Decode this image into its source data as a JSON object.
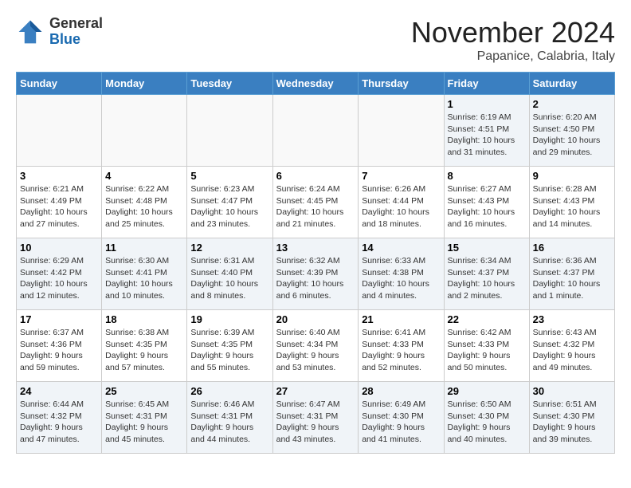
{
  "header": {
    "logo_line1": "General",
    "logo_line2": "Blue",
    "month": "November 2024",
    "location": "Papanice, Calabria, Italy"
  },
  "days_of_week": [
    "Sunday",
    "Monday",
    "Tuesday",
    "Wednesday",
    "Thursday",
    "Friday",
    "Saturday"
  ],
  "weeks": [
    [
      {
        "day": "",
        "detail": ""
      },
      {
        "day": "",
        "detail": ""
      },
      {
        "day": "",
        "detail": ""
      },
      {
        "day": "",
        "detail": ""
      },
      {
        "day": "",
        "detail": ""
      },
      {
        "day": "1",
        "detail": "Sunrise: 6:19 AM\nSunset: 4:51 PM\nDaylight: 10 hours\nand 31 minutes."
      },
      {
        "day": "2",
        "detail": "Sunrise: 6:20 AM\nSunset: 4:50 PM\nDaylight: 10 hours\nand 29 minutes."
      }
    ],
    [
      {
        "day": "3",
        "detail": "Sunrise: 6:21 AM\nSunset: 4:49 PM\nDaylight: 10 hours\nand 27 minutes."
      },
      {
        "day": "4",
        "detail": "Sunrise: 6:22 AM\nSunset: 4:48 PM\nDaylight: 10 hours\nand 25 minutes."
      },
      {
        "day": "5",
        "detail": "Sunrise: 6:23 AM\nSunset: 4:47 PM\nDaylight: 10 hours\nand 23 minutes."
      },
      {
        "day": "6",
        "detail": "Sunrise: 6:24 AM\nSunset: 4:45 PM\nDaylight: 10 hours\nand 21 minutes."
      },
      {
        "day": "7",
        "detail": "Sunrise: 6:26 AM\nSunset: 4:44 PM\nDaylight: 10 hours\nand 18 minutes."
      },
      {
        "day": "8",
        "detail": "Sunrise: 6:27 AM\nSunset: 4:43 PM\nDaylight: 10 hours\nand 16 minutes."
      },
      {
        "day": "9",
        "detail": "Sunrise: 6:28 AM\nSunset: 4:43 PM\nDaylight: 10 hours\nand 14 minutes."
      }
    ],
    [
      {
        "day": "10",
        "detail": "Sunrise: 6:29 AM\nSunset: 4:42 PM\nDaylight: 10 hours\nand 12 minutes."
      },
      {
        "day": "11",
        "detail": "Sunrise: 6:30 AM\nSunset: 4:41 PM\nDaylight: 10 hours\nand 10 minutes."
      },
      {
        "day": "12",
        "detail": "Sunrise: 6:31 AM\nSunset: 4:40 PM\nDaylight: 10 hours\nand 8 minutes."
      },
      {
        "day": "13",
        "detail": "Sunrise: 6:32 AM\nSunset: 4:39 PM\nDaylight: 10 hours\nand 6 minutes."
      },
      {
        "day": "14",
        "detail": "Sunrise: 6:33 AM\nSunset: 4:38 PM\nDaylight: 10 hours\nand 4 minutes."
      },
      {
        "day": "15",
        "detail": "Sunrise: 6:34 AM\nSunset: 4:37 PM\nDaylight: 10 hours\nand 2 minutes."
      },
      {
        "day": "16",
        "detail": "Sunrise: 6:36 AM\nSunset: 4:37 PM\nDaylight: 10 hours\nand 1 minute."
      }
    ],
    [
      {
        "day": "17",
        "detail": "Sunrise: 6:37 AM\nSunset: 4:36 PM\nDaylight: 9 hours\nand 59 minutes."
      },
      {
        "day": "18",
        "detail": "Sunrise: 6:38 AM\nSunset: 4:35 PM\nDaylight: 9 hours\nand 57 minutes."
      },
      {
        "day": "19",
        "detail": "Sunrise: 6:39 AM\nSunset: 4:35 PM\nDaylight: 9 hours\nand 55 minutes."
      },
      {
        "day": "20",
        "detail": "Sunrise: 6:40 AM\nSunset: 4:34 PM\nDaylight: 9 hours\nand 53 minutes."
      },
      {
        "day": "21",
        "detail": "Sunrise: 6:41 AM\nSunset: 4:33 PM\nDaylight: 9 hours\nand 52 minutes."
      },
      {
        "day": "22",
        "detail": "Sunrise: 6:42 AM\nSunset: 4:33 PM\nDaylight: 9 hours\nand 50 minutes."
      },
      {
        "day": "23",
        "detail": "Sunrise: 6:43 AM\nSunset: 4:32 PM\nDaylight: 9 hours\nand 49 minutes."
      }
    ],
    [
      {
        "day": "24",
        "detail": "Sunrise: 6:44 AM\nSunset: 4:32 PM\nDaylight: 9 hours\nand 47 minutes."
      },
      {
        "day": "25",
        "detail": "Sunrise: 6:45 AM\nSunset: 4:31 PM\nDaylight: 9 hours\nand 45 minutes."
      },
      {
        "day": "26",
        "detail": "Sunrise: 6:46 AM\nSunset: 4:31 PM\nDaylight: 9 hours\nand 44 minutes."
      },
      {
        "day": "27",
        "detail": "Sunrise: 6:47 AM\nSunset: 4:31 PM\nDaylight: 9 hours\nand 43 minutes."
      },
      {
        "day": "28",
        "detail": "Sunrise: 6:49 AM\nSunset: 4:30 PM\nDaylight: 9 hours\nand 41 minutes."
      },
      {
        "day": "29",
        "detail": "Sunrise: 6:50 AM\nSunset: 4:30 PM\nDaylight: 9 hours\nand 40 minutes."
      },
      {
        "day": "30",
        "detail": "Sunrise: 6:51 AM\nSunset: 4:30 PM\nDaylight: 9 hours\nand 39 minutes."
      }
    ]
  ]
}
